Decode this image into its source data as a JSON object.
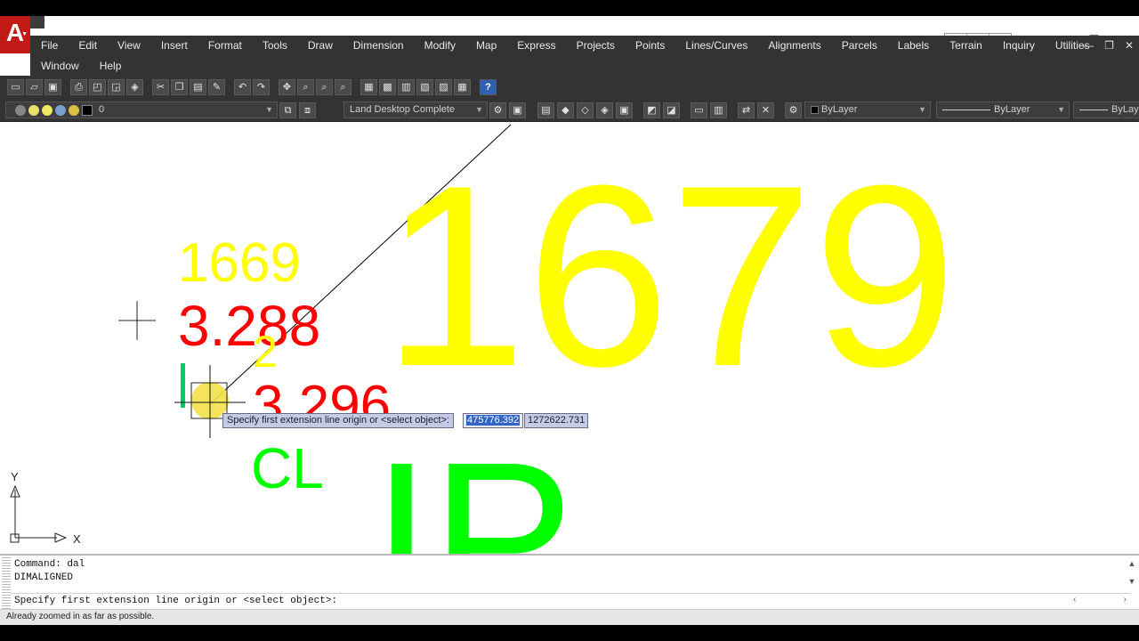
{
  "app": {
    "logo_letter": "A",
    "title_search_icons": [
      "search-icon",
      "key-icon",
      "star-icon"
    ],
    "window_controls": [
      "—",
      "❐",
      "✕"
    ],
    "mdi_controls": [
      "—",
      "❐",
      "✕"
    ]
  },
  "menu": {
    "row1": [
      "File",
      "Edit",
      "View",
      "Insert",
      "Format",
      "Tools",
      "Draw",
      "Dimension",
      "Modify",
      "Map",
      "Express",
      "Projects",
      "Points",
      "Lines/Curves",
      "Alignments",
      "Parcels",
      "Labels",
      "Terrain",
      "Inquiry",
      "Utilities"
    ],
    "row2": [
      "Window",
      "Help"
    ]
  },
  "toolbar": {
    "layer_value": "0",
    "style_value": "Land Desktop Complete",
    "color_value": "ByLayer",
    "linetype_value": "ByLayer",
    "lineweight_value": "ByLayer",
    "help_label": "?"
  },
  "drawing": {
    "label_1669": "1669",
    "label_3288": "3.288",
    "label_2": "2",
    "label_3296": "3.296",
    "label_cl": "CL",
    "label_1679": "1679",
    "label_ip": "IP",
    "ucs_x": "X",
    "ucs_y": "Y",
    "colors": {
      "yellow": "#ffff00",
      "red": "#ff0000",
      "green": "#00ff00",
      "line": "#000000"
    }
  },
  "dynamic_input": {
    "prompt": "Specify first extension line origin or <select object>:",
    "x_value": "475776.392",
    "y_value": "1272622.731"
  },
  "command": {
    "history": [
      "Command: dal",
      "DIMALIGNED"
    ],
    "current": "Specify first extension line origin or <select object>:"
  },
  "status": {
    "message": "Already zoomed in as far as possible."
  }
}
